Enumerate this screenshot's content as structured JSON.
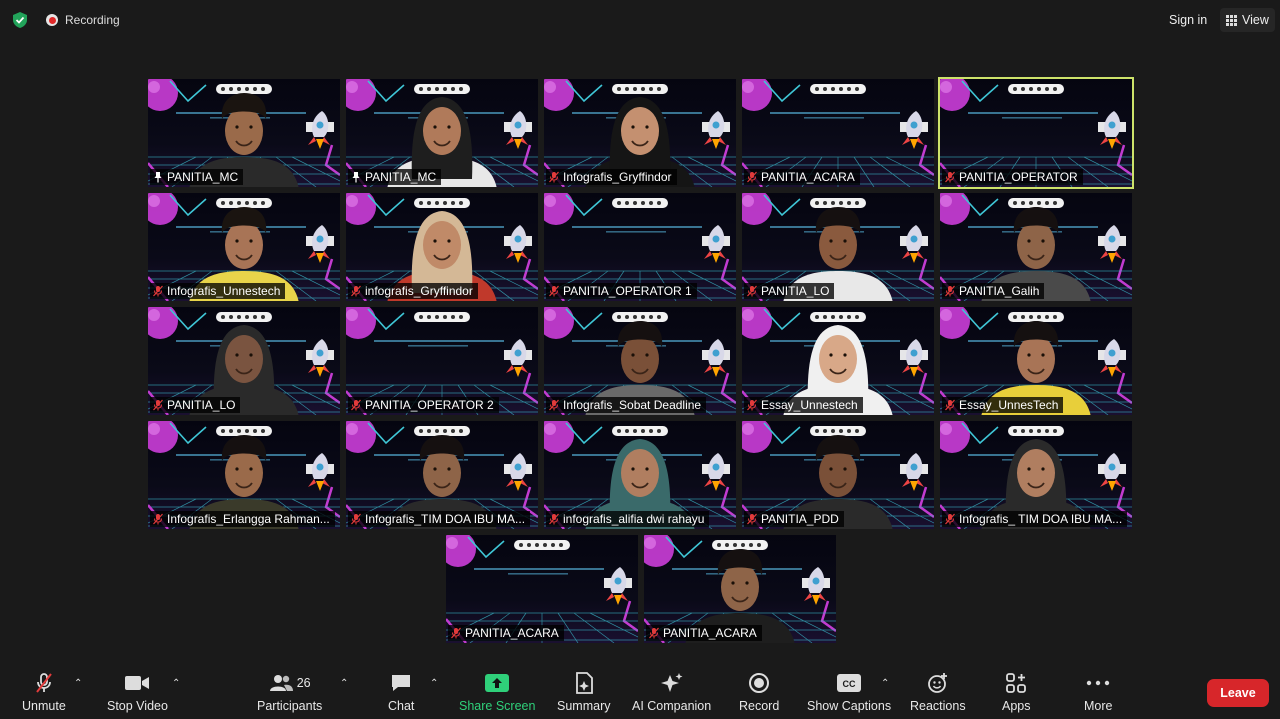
{
  "topbar": {
    "recording_label": "Recording",
    "signin_label": "Sign in",
    "view_label": "View"
  },
  "tiles": [
    {
      "name": "PANITIA_MC",
      "icon": "pin-icon",
      "person": true,
      "skin": "#9a6a4a",
      "hair": "#1a1410",
      "shirt": "#2a2a2a",
      "hijab": false,
      "active": false
    },
    {
      "name": "PANITIA_MC",
      "icon": "pin-icon",
      "person": true,
      "skin": "#b07a5a",
      "hair": "#1e1e1e",
      "shirt": "#e8e8e8",
      "hijab": true,
      "active": false
    },
    {
      "name": "Infografis_Gryffindor",
      "icon": "mic-off-icon",
      "person": true,
      "skin": "#c49070",
      "hair": "#151515",
      "shirt": "#151515",
      "hijab": true,
      "active": false
    },
    {
      "name": "PANITIA_ACARA",
      "icon": "mic-off-icon",
      "person": false,
      "active": false
    },
    {
      "name": "PANITIA_OPERATOR",
      "icon": "mic-off-icon",
      "person": false,
      "active": true
    },
    {
      "name": "Infografis_Unnestech",
      "icon": "mic-off-icon",
      "person": true,
      "skin": "#a87456",
      "hair": "#1a1410",
      "shirt": "#e8d44a",
      "hijab": false,
      "active": false
    },
    {
      "name": "infografis_Gryffindor",
      "icon": "mic-off-icon",
      "person": true,
      "skin": "#c08a68",
      "hair": "#d4b896",
      "shirt": "#c0392b",
      "hijab": true,
      "active": false
    },
    {
      "name": "PANITIA_OPERATOR 1",
      "icon": "mic-off-icon",
      "person": false,
      "active": false
    },
    {
      "name": "PANITIA_LO",
      "icon": "mic-off-icon",
      "person": true,
      "skin": "#8a5a3e",
      "hair": "#151010",
      "shirt": "#e8e8e8",
      "hijab": false,
      "active": false
    },
    {
      "name": "PANITIA_Galih",
      "icon": "mic-off-icon",
      "person": true,
      "skin": "#8e6448",
      "hair": "#151010",
      "shirt": "#4a4a4a",
      "hijab": false,
      "active": false
    },
    {
      "name": "PANITIA_LO",
      "icon": "mic-off-icon",
      "person": true,
      "skin": "#7a5440",
      "hair": "#2a2a2a",
      "shirt": "#2a2a2a",
      "hijab": true,
      "active": false
    },
    {
      "name": "PANITIA_OPERATOR 2",
      "icon": "mic-off-icon",
      "person": false,
      "active": false
    },
    {
      "name": "Infografis_Sobat Deadline",
      "icon": "mic-off-icon",
      "person": true,
      "skin": "#7a5038",
      "hair": "#151010",
      "shirt": "#6a6a6a",
      "hijab": false,
      "active": false
    },
    {
      "name": "Essay_Unnestech",
      "icon": "mic-off-icon",
      "person": true,
      "skin": "#d8a888",
      "hair": "#f0f0f0",
      "shirt": "#f0f0f0",
      "hijab": true,
      "active": false
    },
    {
      "name": "Essay_UnnesTech",
      "icon": "mic-off-icon",
      "person": true,
      "skin": "#a87456",
      "hair": "#151010",
      "shirt": "#e8cf3a",
      "hijab": false,
      "active": false
    },
    {
      "name": "Infografis_Erlangga Rahman...",
      "icon": "mic-off-icon",
      "person": true,
      "skin": "#9a6a4a",
      "hair": "#151010",
      "shirt": "#3a3a2a",
      "hijab": false,
      "active": false
    },
    {
      "name": "Infografis_TIM DOA IBU MA...",
      "icon": "mic-off-icon",
      "person": true,
      "skin": "#8e6448",
      "hair": "#151010",
      "shirt": "#2a2a2a",
      "hijab": false,
      "active": false
    },
    {
      "name": "infografis_alifia dwi rahayu",
      "icon": "mic-off-icon",
      "person": true,
      "skin": "#b07e60",
      "hair": "#3a6a6a",
      "shirt": "#3a6a6a",
      "hijab": true,
      "active": false
    },
    {
      "name": "PANITIA_PDD",
      "icon": "mic-off-icon",
      "person": true,
      "skin": "#7a5038",
      "hair": "#151010",
      "shirt": "#2a2a2a",
      "hijab": false,
      "active": false
    },
    {
      "name": "Infografis_ TIM DOA IBU MA...",
      "icon": "mic-off-icon",
      "person": true,
      "skin": "#b07e60",
      "hair": "#2a2a2a",
      "shirt": "#2a2a2a",
      "hijab": true,
      "active": false
    },
    {
      "name": "PANITIA_ACARA",
      "icon": "mic-off-icon",
      "person": false,
      "active": false
    },
    {
      "name": "PANITIA_ACARA",
      "icon": "mic-off-icon",
      "person": true,
      "skin": "#8e6448",
      "hair": "#151010",
      "shirt": "#1e1e1e",
      "hijab": false,
      "active": false
    }
  ],
  "toolbar": {
    "unmute": "Unmute",
    "stop_video": "Stop Video",
    "participants": "Participants",
    "participant_count": "26",
    "chat": "Chat",
    "share_screen": "Share Screen",
    "summary": "Summary",
    "ai_companion": "AI Companion",
    "record": "Record",
    "show_captions": "Show Captions",
    "reactions": "Reactions",
    "apps": "Apps",
    "more": "More",
    "leave": "Leave"
  },
  "colors": {
    "background": "#1a1a1a",
    "active_border": "#cde36a",
    "share_green": "#2fd07a",
    "leave_red": "#d7262a"
  }
}
